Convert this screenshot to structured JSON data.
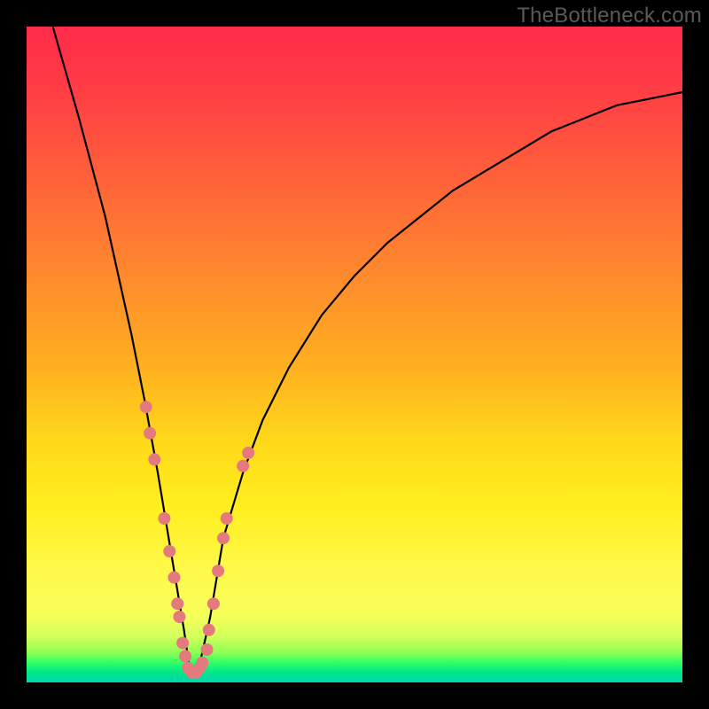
{
  "watermark": "TheBottleneck.com",
  "colors": {
    "frame": "#000000",
    "curve": "#000000",
    "dots": "#e47a7e",
    "gradient_top": "#ff2b4a",
    "gradient_bottom": "#00d7b0"
  },
  "chart_data": {
    "type": "line",
    "title": "",
    "xlabel": "",
    "ylabel": "",
    "xlim": [
      0,
      100
    ],
    "ylim": [
      0,
      100
    ],
    "note": "Axes are unlabeled. Values below are read off the curve as percentage of plot width (x) and plot height (y), where y=0 is the bottom (green) and y=100 is the top (red). The curve is a V-shape with minimum near x≈25.",
    "series": [
      {
        "name": "bottleneck-curve",
        "x": [
          4,
          8,
          12,
          16,
          18,
          20,
          22,
          24,
          25,
          26,
          28,
          30,
          33,
          36,
          40,
          45,
          50,
          55,
          60,
          65,
          70,
          75,
          80,
          85,
          90,
          95,
          100
        ],
        "y": [
          100,
          86,
          71,
          53,
          43,
          32,
          20,
          8,
          1,
          1,
          10,
          22,
          32,
          40,
          48,
          56,
          62,
          67,
          71,
          75,
          78,
          81,
          84,
          86,
          88,
          89,
          90
        ]
      }
    ],
    "scatter_points": {
      "name": "sample-marks",
      "note": "Salmon-colored dots clustered along the lower V of the curve.",
      "points": [
        {
          "x": 18.2,
          "y": 42
        },
        {
          "x": 18.8,
          "y": 38
        },
        {
          "x": 19.5,
          "y": 34
        },
        {
          "x": 21.0,
          "y": 25
        },
        {
          "x": 21.8,
          "y": 20
        },
        {
          "x": 22.5,
          "y": 16
        },
        {
          "x": 23.0,
          "y": 12
        },
        {
          "x": 23.3,
          "y": 10
        },
        {
          "x": 23.8,
          "y": 6
        },
        {
          "x": 24.2,
          "y": 4
        },
        {
          "x": 24.6,
          "y": 2.2
        },
        {
          "x": 25.2,
          "y": 1.5
        },
        {
          "x": 25.8,
          "y": 1.5
        },
        {
          "x": 26.4,
          "y": 2.2
        },
        {
          "x": 26.8,
          "y": 3
        },
        {
          "x": 27.5,
          "y": 5
        },
        {
          "x": 27.8,
          "y": 8
        },
        {
          "x": 28.5,
          "y": 12
        },
        {
          "x": 29.2,
          "y": 17
        },
        {
          "x": 30.0,
          "y": 22
        },
        {
          "x": 30.5,
          "y": 25
        },
        {
          "x": 33.0,
          "y": 33
        },
        {
          "x": 33.8,
          "y": 35
        }
      ]
    }
  }
}
